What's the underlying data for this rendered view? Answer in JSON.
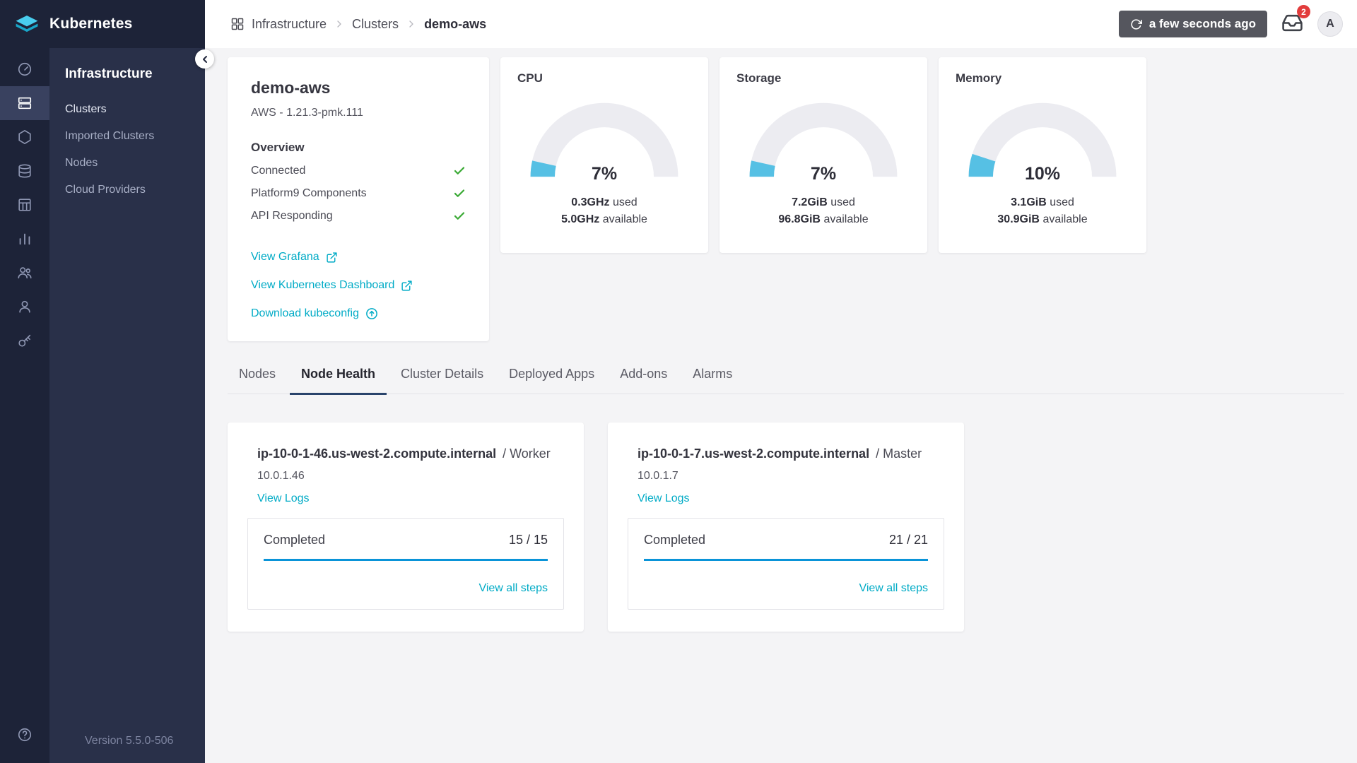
{
  "app": {
    "name": "Kubernetes",
    "version": "Version 5.5.0-506"
  },
  "colors": {
    "accent_teal": "#00abc6",
    "progress_blue": "#0a94d8",
    "gauge_arc": "#56c0e4",
    "gauge_track": "#ececf1",
    "check_green": "#3aaa35",
    "badge_red": "#e23c3c",
    "sidebar_navy": "#293049",
    "tab_underline": "#29436b"
  },
  "topbar": {
    "breadcrumb": [
      "Infrastructure",
      "Clusters",
      "demo-aws"
    ],
    "refresh_label": "a few seconds ago",
    "notification_count": "2",
    "avatar_initial": "A"
  },
  "sidebar": {
    "section": "Infrastructure",
    "items": [
      {
        "label": "Clusters",
        "active": true
      },
      {
        "label": "Imported Clusters",
        "active": false
      },
      {
        "label": "Nodes",
        "active": false
      },
      {
        "label": "Cloud Providers",
        "active": false
      }
    ]
  },
  "cluster": {
    "name": "demo-aws",
    "subtitle": "AWS - 1.21.3-pmk.111",
    "overview_title": "Overview",
    "checks": [
      "Connected",
      "Platform9 Components",
      "API Responding"
    ],
    "links": {
      "grafana": "View Grafana",
      "dashboard": "View Kubernetes Dashboard",
      "kubeconfig": "Download kubeconfig"
    }
  },
  "gauges": [
    {
      "title": "CPU",
      "percent": 7,
      "percent_label": "7%",
      "used_value": "0.3GHz",
      "used_suffix": "used",
      "available_value": "5.0GHz",
      "available_suffix": "available"
    },
    {
      "title": "Storage",
      "percent": 7,
      "percent_label": "7%",
      "used_value": "7.2GiB",
      "used_suffix": "used",
      "available_value": "96.8GiB",
      "available_suffix": "available"
    },
    {
      "title": "Memory",
      "percent": 10,
      "percent_label": "10%",
      "used_value": "3.1GiB",
      "used_suffix": "used",
      "available_value": "30.9GiB",
      "available_suffix": "available"
    }
  ],
  "tabs": [
    {
      "label": "Nodes",
      "active": false
    },
    {
      "label": "Node Health",
      "active": true
    },
    {
      "label": "Cluster Details",
      "active": false
    },
    {
      "label": "Deployed Apps",
      "active": false
    },
    {
      "label": "Add-ons",
      "active": false
    },
    {
      "label": "Alarms",
      "active": false
    }
  ],
  "nodes": [
    {
      "hostname": "ip-10-0-1-46.us-west-2.compute.internal",
      "role": "/ Worker",
      "ip": "10.0.1.46",
      "view_logs": "View Logs",
      "status": "Completed",
      "steps": "15 / 15",
      "progress_percent": 100,
      "view_all": "View all steps"
    },
    {
      "hostname": "ip-10-0-1-7.us-west-2.compute.internal",
      "role": "/ Master",
      "ip": "10.0.1.7",
      "view_logs": "View Logs",
      "status": "Completed",
      "steps": "21 / 21",
      "progress_percent": 100,
      "view_all": "View all steps"
    }
  ]
}
